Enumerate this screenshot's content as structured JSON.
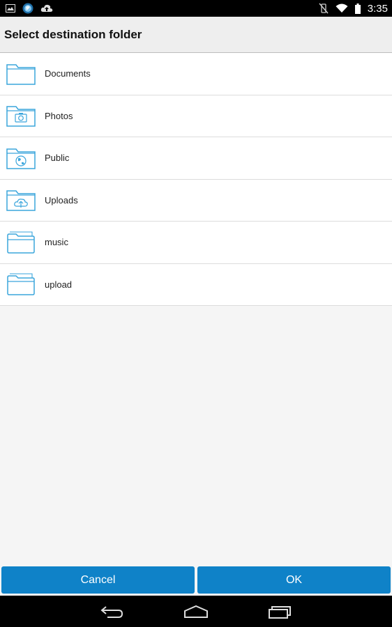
{
  "status_bar": {
    "time": "3:35",
    "left_icons": [
      "image-icon",
      "app-globe-icon",
      "cloud-upload-icon"
    ],
    "right_icons": [
      "vibrate-off-icon",
      "wifi-icon",
      "battery-icon"
    ]
  },
  "dialog": {
    "title": "Select destination folder",
    "folders": [
      {
        "label": "Documents",
        "icon": "folder-icon"
      },
      {
        "label": "Photos",
        "icon": "camera-folder-icon"
      },
      {
        "label": "Public",
        "icon": "globe-folder-icon"
      },
      {
        "label": "Uploads",
        "icon": "upload-folder-icon"
      },
      {
        "label": "music",
        "icon": "open-folder-icon"
      },
      {
        "label": "upload",
        "icon": "open-folder-icon"
      }
    ],
    "cancel_label": "Cancel",
    "ok_label": "OK"
  },
  "nav_bar": {
    "icons": [
      "back-icon",
      "home-icon",
      "recent-apps-icon"
    ]
  },
  "colors": {
    "accent": "#0f82c8",
    "folder_stroke": "#3aa5dc"
  }
}
